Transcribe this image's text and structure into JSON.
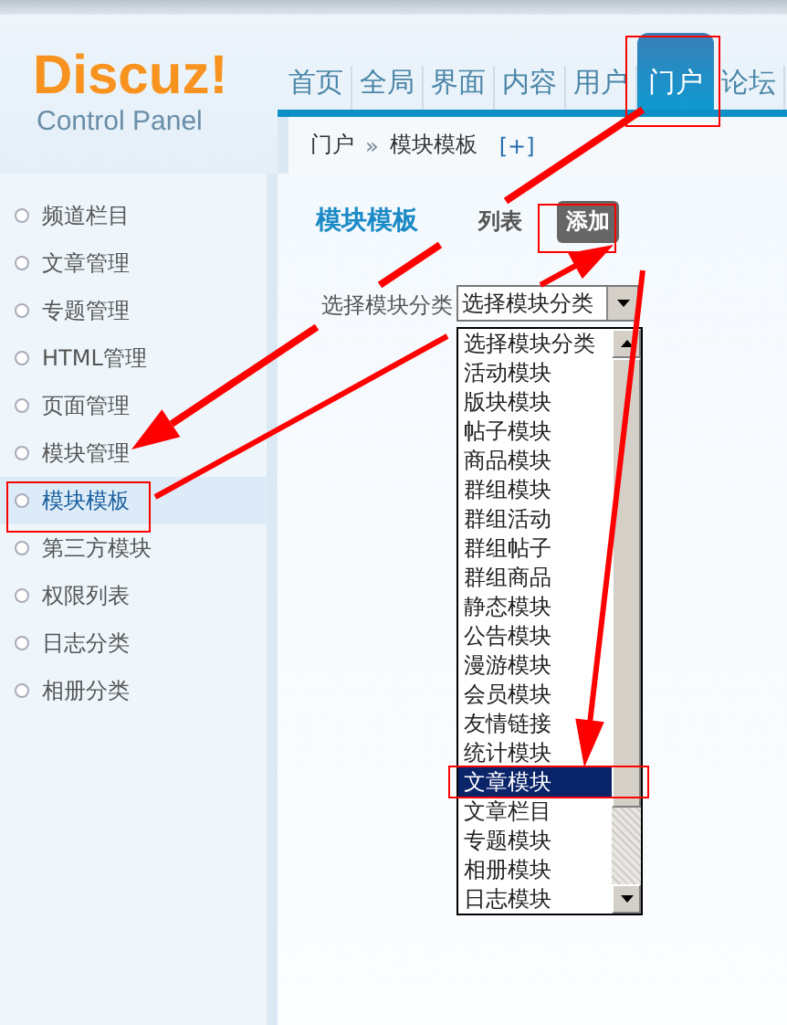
{
  "logo": {
    "title": "Discuz!",
    "subtitle": "Control Panel"
  },
  "nav": [
    {
      "label": "首页",
      "selected": false
    },
    {
      "label": "全局",
      "selected": false
    },
    {
      "label": "界面",
      "selected": false
    },
    {
      "label": "内容",
      "selected": false
    },
    {
      "label": "用户",
      "selected": false
    },
    {
      "label": "门户",
      "selected": true
    },
    {
      "label": "论坛",
      "selected": false
    }
  ],
  "breadcrumb": {
    "items": [
      "门户",
      "模块模板"
    ],
    "separator": "»",
    "add": "[+]"
  },
  "sidebar": {
    "items": [
      {
        "label": "频道栏目",
        "selected": false
      },
      {
        "label": "文章管理",
        "selected": false
      },
      {
        "label": "专题管理",
        "selected": false
      },
      {
        "label": "HTML管理",
        "selected": false
      },
      {
        "label": "页面管理",
        "selected": false
      },
      {
        "label": "模块管理",
        "selected": false
      },
      {
        "label": "模块模板",
        "selected": true
      },
      {
        "label": "第三方模块",
        "selected": false
      },
      {
        "label": "权限列表",
        "selected": false
      },
      {
        "label": "日志分类",
        "selected": false
      },
      {
        "label": "相册分类",
        "selected": false
      }
    ]
  },
  "page": {
    "title": "模块模板",
    "tabs": [
      {
        "label": "列表",
        "selected": false
      },
      {
        "label": "添加",
        "selected": true
      }
    ]
  },
  "form": {
    "label": "选择模块分类",
    "select": {
      "value": "选择模块分类",
      "options": [
        {
          "label": "选择模块分类",
          "highlighted": false
        },
        {
          "label": "活动模块",
          "highlighted": false
        },
        {
          "label": "版块模块",
          "highlighted": false
        },
        {
          "label": "帖子模块",
          "highlighted": false
        },
        {
          "label": "商品模块",
          "highlighted": false
        },
        {
          "label": "群组模块",
          "highlighted": false
        },
        {
          "label": "群组活动",
          "highlighted": false
        },
        {
          "label": "群组帖子",
          "highlighted": false
        },
        {
          "label": "群组商品",
          "highlighted": false
        },
        {
          "label": "静态模块",
          "highlighted": false
        },
        {
          "label": "公告模块",
          "highlighted": false
        },
        {
          "label": "漫游模块",
          "highlighted": false
        },
        {
          "label": "会员模块",
          "highlighted": false
        },
        {
          "label": "友情链接",
          "highlighted": false
        },
        {
          "label": "统计模块",
          "highlighted": false
        },
        {
          "label": "文章模块",
          "highlighted": true
        },
        {
          "label": "文章栏目",
          "highlighted": false
        },
        {
          "label": "专题模块",
          "highlighted": false
        },
        {
          "label": "相册模块",
          "highlighted": false
        },
        {
          "label": "日志模块",
          "highlighted": false
        }
      ]
    }
  }
}
